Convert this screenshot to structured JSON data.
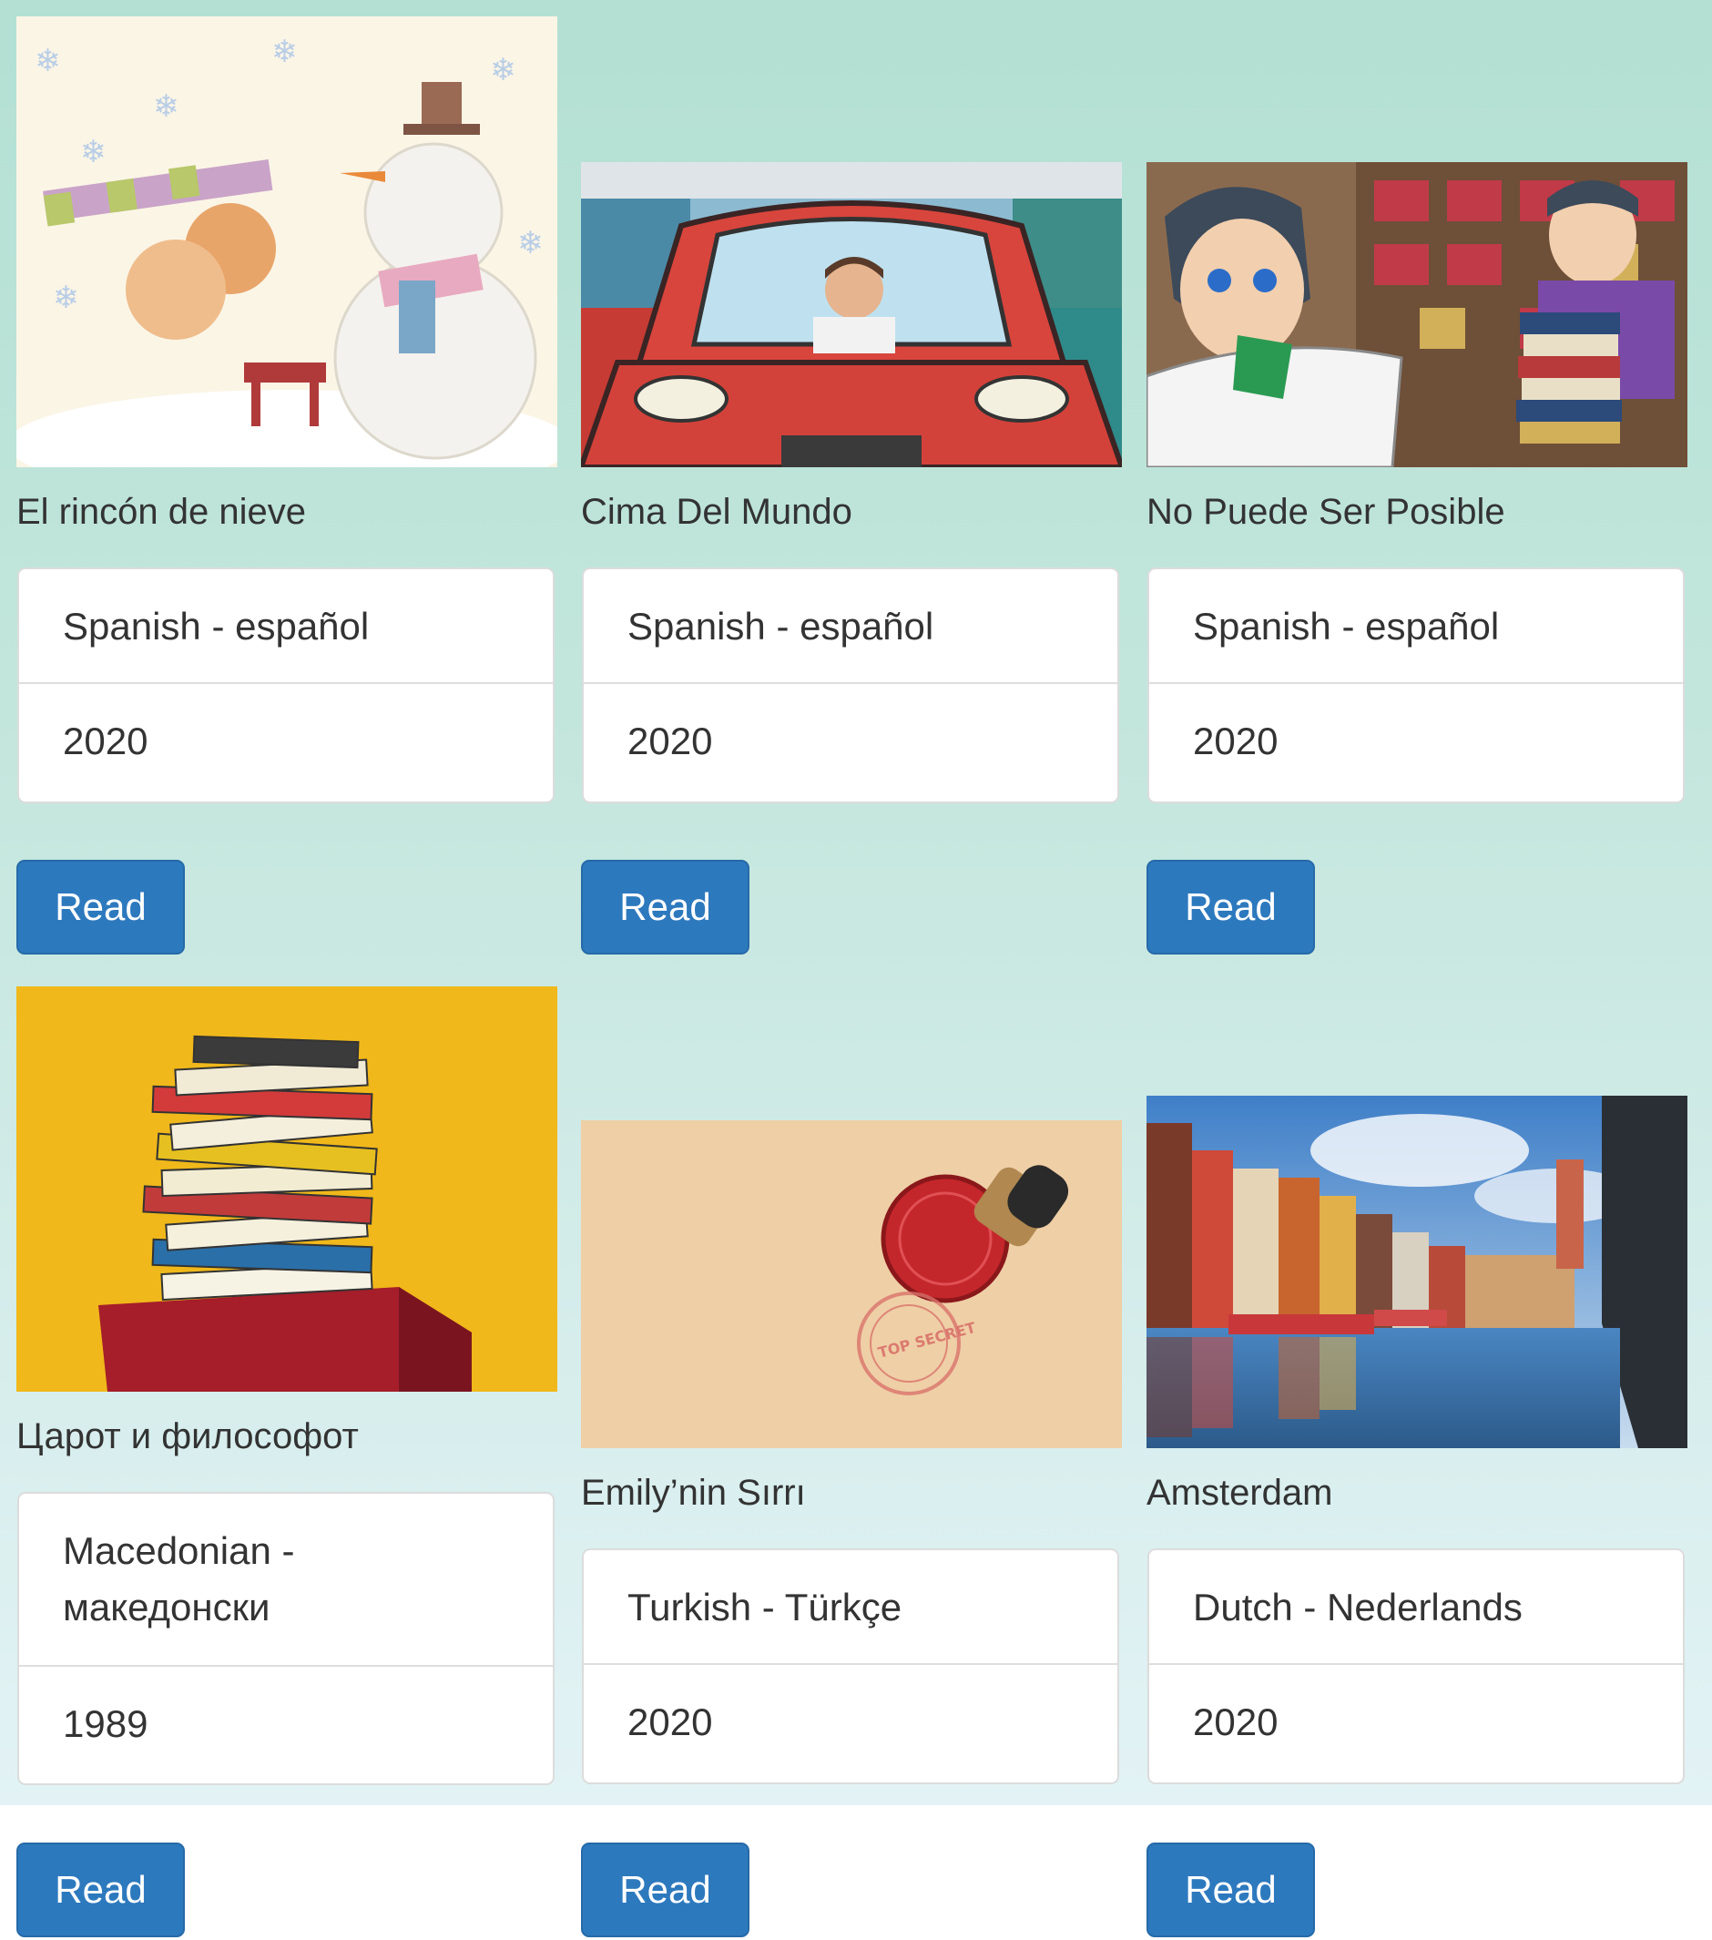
{
  "books": [
    {
      "title": "El rincón de nieve",
      "language": "Spanish - español",
      "year": "2020",
      "button": "Read"
    },
    {
      "title": "Cima Del Mundo",
      "language": "Spanish - español",
      "year": "2020",
      "button": "Read"
    },
    {
      "title": "No Puede Ser Posible",
      "language": "Spanish - español",
      "year": "2020",
      "button": "Read"
    },
    {
      "title": "Царот и философот",
      "language": "Macedonian - македонски",
      "year": "1989",
      "button": "Read"
    },
    {
      "title": "Emily’nin Sırrı",
      "language": "Turkish - Türkçe",
      "year": "2020",
      "button": "Read"
    },
    {
      "title": "Amsterdam",
      "language": "Dutch - Nederlands",
      "year": "2020",
      "button": "Read"
    }
  ]
}
